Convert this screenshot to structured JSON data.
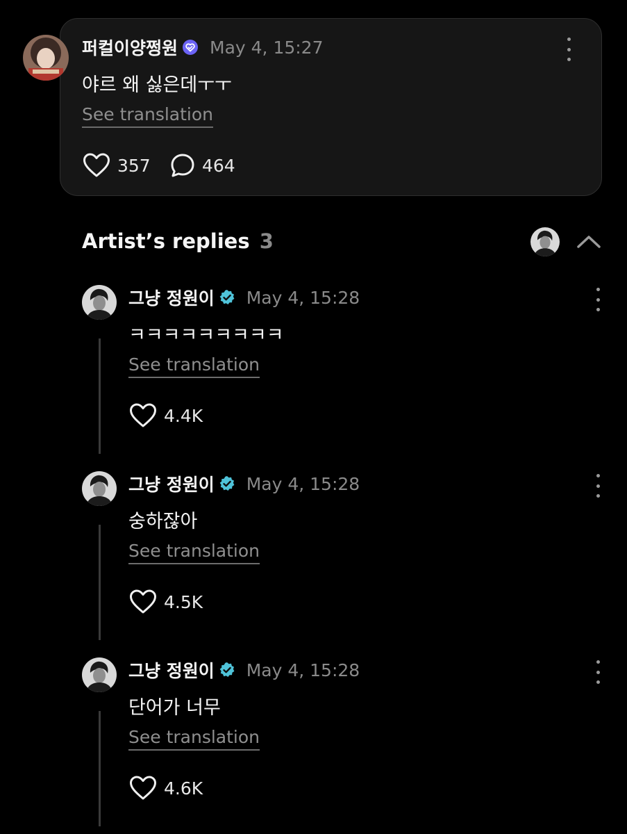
{
  "post": {
    "username": "퍼컬이양쩡원",
    "verified_icon": "verified-badge-purple",
    "timestamp": "May 4, 15:27",
    "text": "야르 왜 싫은데ㅜㅜ",
    "translate_label": "See translation",
    "likes": "357",
    "comments": "464",
    "menu_icon": "more-vertical-icon"
  },
  "replies_section": {
    "title": "Artist’s replies",
    "count": "3",
    "collapse_icon": "chevron-up-icon"
  },
  "replies": [
    {
      "username": "그냥 정원이",
      "verified_icon": "verified-badge-teal",
      "timestamp": "May 4, 15:28",
      "text": "ㅋㅋㅋㅋㅋㅋㅋㅋㅋ",
      "translate_label": "See translation",
      "likes": "4.4K"
    },
    {
      "username": "그냥 정원이",
      "verified_icon": "verified-badge-teal",
      "timestamp": "May 4, 15:28",
      "text": "숭하잖아",
      "translate_label": "See translation",
      "likes": "4.5K"
    },
    {
      "username": "그냥 정원이",
      "verified_icon": "verified-badge-teal",
      "timestamp": "May 4, 15:28",
      "text": "단어가 너무",
      "translate_label": "See translation",
      "likes": "4.6K"
    }
  ],
  "colors": {
    "background": "#000000",
    "card": "#161616",
    "muted_text": "#8a8a8a",
    "purple_badge": "#6b63f5",
    "teal_badge": "#4fc3d9"
  }
}
